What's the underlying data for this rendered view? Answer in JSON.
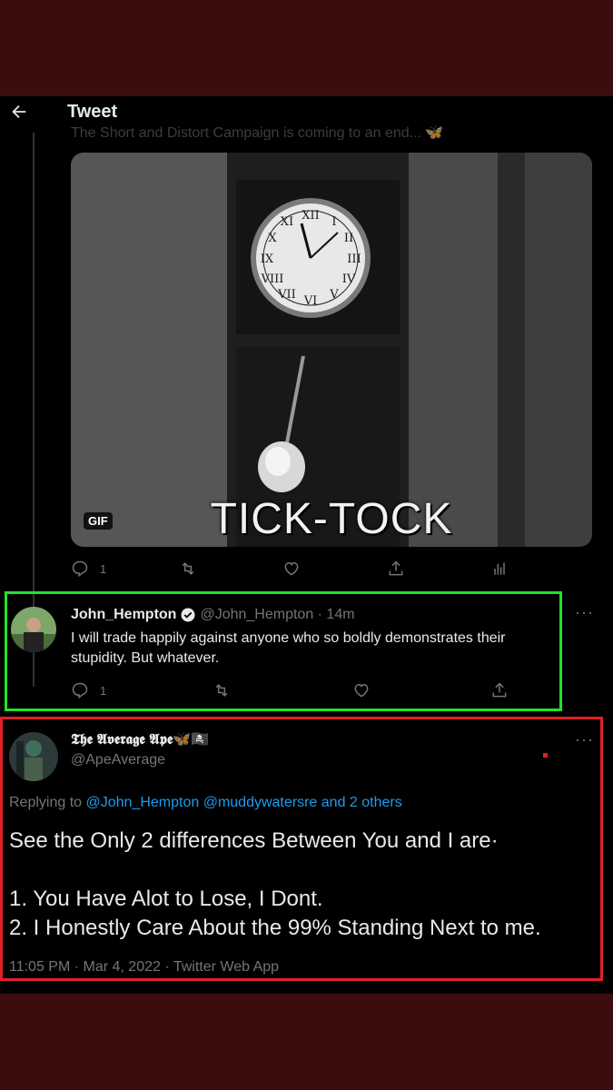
{
  "header": {
    "back_icon": "arrow-left-icon",
    "title": "Tweet",
    "parent_preview": "The Short and Distort Campaign is coming to an end... 🦋"
  },
  "parent_tweet": {
    "media_badge": "GIF",
    "media_caption": "TICK-TOCK",
    "actions": {
      "reply_count": "1",
      "retweet_count": "",
      "like_count": ""
    }
  },
  "reply_1": {
    "display_name": "John_Hempton",
    "verified": true,
    "handle_time": "@John_Hempton · 14m",
    "text": "I will trade happily against anyone who so boldly demonstrates their stupidity. But whatever.",
    "reply_count": "1",
    "more": "···"
  },
  "main_tweet": {
    "display_name": "𝕿𝖍𝖊 𝕬𝖛𝖊𝖗𝖆𝖌𝖊 𝕬𝖕𝖊🦋🏴‍☠️",
    "handle": "@ApeAverage",
    "more": "···",
    "replying_prefix": "Replying to ",
    "replying_targets": "@John_Hempton @muddywatersre and 2 others",
    "line_1": "See the Only 2 differences Between You and I are·",
    "line_2": "1. You Have Alot to Lose, I Dont.",
    "line_3": "2. I Honestly Care About the 99% Standing Next to me.",
    "meta": "11:05 PM · Mar 4, 2022 · Twitter Web App"
  },
  "colors": {
    "page_bg": "#3d0c0c",
    "green_highlight": "#22e22b",
    "red_highlight": "#e0202a",
    "link": "#1d9bf0"
  }
}
